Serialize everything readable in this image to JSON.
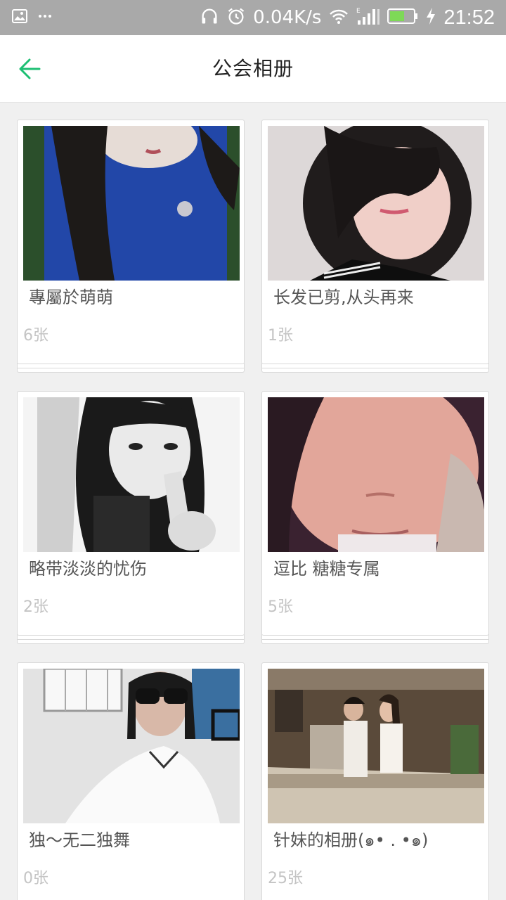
{
  "status_bar": {
    "network_speed": "0.04K/s",
    "time": "21:52",
    "icons": [
      "image-icon",
      "more-dots-icon",
      "headphones-icon",
      "alarm-icon",
      "wifi-icon",
      "signal-icon",
      "battery-icon",
      "charging-icon"
    ]
  },
  "header": {
    "title": "公会相册",
    "back_icon": "arrow-left-icon"
  },
  "albums": [
    {
      "name": "專屬於萌萌",
      "count": "6张"
    },
    {
      "name": "长发已剪,从头再来",
      "count": "1张"
    },
    {
      "name": "略带淡淡的忧伤",
      "count": "2张"
    },
    {
      "name": "逗比 糖糖专属",
      "count": "5张"
    },
    {
      "name": "独〜无二独舞",
      "count": "0张"
    },
    {
      "name": "针妹的相册(๑• . •๑)",
      "count": "25张"
    }
  ],
  "colors": {
    "accent": "#1dbf73",
    "status_bar": "#a9a9a9"
  }
}
